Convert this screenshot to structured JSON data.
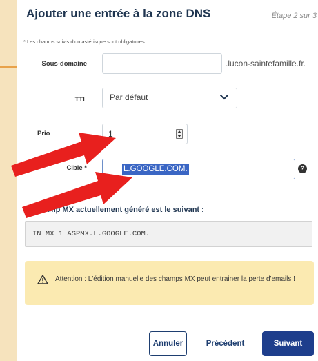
{
  "dialog": {
    "title": "Ajouter une entrée à la zone DNS",
    "step": "Étape 2 sur 3",
    "required_note": "* Les champs suivis d'un astérisque sont obligatoires."
  },
  "form": {
    "subdomain": {
      "label": "Sous-domaine",
      "value": "",
      "suffix": ".lucon-saintefamille.fr."
    },
    "ttl": {
      "label": "TTL",
      "value": "Par défaut"
    },
    "priority": {
      "label": "Priorité",
      "label_visible": "Prio",
      "value": "1"
    },
    "target": {
      "label": "Cible *",
      "value_visible": "L.GOOGLE.COM."
    }
  },
  "mx": {
    "heading": "Le champ MX actuellement généré est le suivant :",
    "value": "IN MX 1 ASPMX.L.GOOGLE.COM."
  },
  "warning": {
    "text": "Attention : L'édition manuelle des champs MX peut entrainer la perte d'emails !"
  },
  "buttons": {
    "cancel": "Annuler",
    "previous": "Précédent",
    "next": "Suivant"
  },
  "colors": {
    "background": "#f6e3bd",
    "title": "#1f3550",
    "primary": "#1e3e8c",
    "selection": "#3a66c4",
    "warning_bg": "#fbeab1",
    "arrow": "#e8201e"
  },
  "icons": {
    "ttl_dropdown": "chevron-down-icon",
    "priority_spinner": "spinner-icon",
    "target_help": "question-icon",
    "warning": "warning-triangle-icon"
  }
}
